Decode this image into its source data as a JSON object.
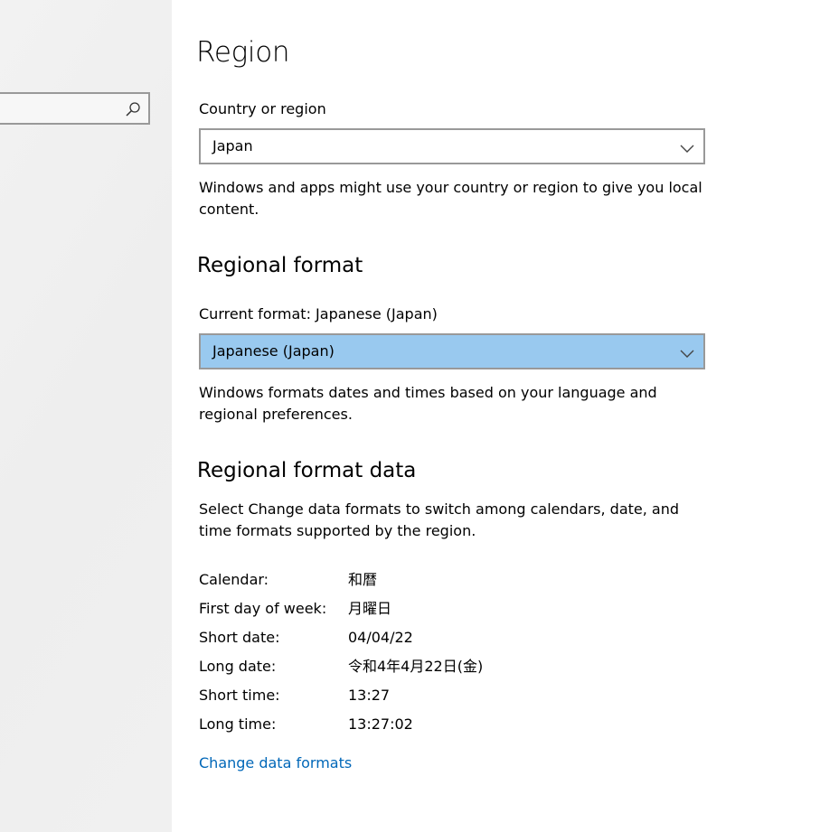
{
  "sidebar": {
    "search": {
      "placeholder": "",
      "icon": "search-icon"
    }
  },
  "main": {
    "title": "Region",
    "country": {
      "label": "Country or region",
      "value": "Japan",
      "description": "Windows and apps might use your country or region to give you local content."
    },
    "regional_format": {
      "heading": "Regional format",
      "current_label": "Current format: Japanese (Japan)",
      "value": "Japanese (Japan)",
      "description": "Windows formats dates and times based on your language and regional preferences."
    },
    "regional_format_data": {
      "heading": "Regional format data",
      "description": "Select Change data formats to switch among calendars, date, and time formats supported by the region.",
      "rows": [
        {
          "label": "Calendar:",
          "value": "和暦"
        },
        {
          "label": "First day of week:",
          "value": "月曜日"
        },
        {
          "label": "Short date:",
          "value": "04/04/22"
        },
        {
          "label": "Long date:",
          "value": "令和4年4月22日(金)"
        },
        {
          "label": "Short time:",
          "value": "13:27"
        },
        {
          "label": "Long time:",
          "value": "13:27:02"
        }
      ],
      "link": "Change data formats"
    }
  },
  "colors": {
    "accent_link": "#0067b8",
    "dropdown_selected_bg": "#99c9ef",
    "border": "#999999"
  }
}
